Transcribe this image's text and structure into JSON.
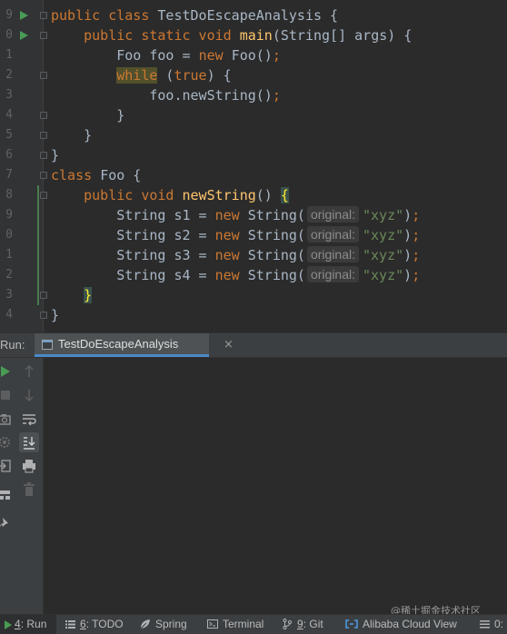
{
  "editor": {
    "line_numbers": [
      "9",
      "0",
      "1",
      "2",
      "3",
      "4",
      "5",
      "6",
      "7",
      "8",
      "9",
      "0",
      "1",
      "2",
      "3",
      "4"
    ],
    "lines": [
      [
        {
          "t": "public class ",
          "c": "kw"
        },
        {
          "t": "TestDoEscapeAnalysis {",
          "c": "ty"
        }
      ],
      [
        {
          "t": "    public static void ",
          "c": "kw"
        },
        {
          "t": "main",
          "c": "fn"
        },
        {
          "t": "(String[] args) {",
          "c": "ty"
        }
      ],
      [
        {
          "t": "        Foo foo = ",
          "c": "ty"
        },
        {
          "t": "new ",
          "c": "kw"
        },
        {
          "t": "Foo()",
          "c": "ty"
        },
        {
          "t": ";",
          "c": "kw"
        }
      ],
      [
        {
          "t": "        ",
          "c": "ty"
        },
        {
          "t": "while",
          "c": "kw hl"
        },
        {
          "t": " (",
          "c": "ty"
        },
        {
          "t": "true",
          "c": "kw"
        },
        {
          "t": ") {",
          "c": "ty"
        }
      ],
      [
        {
          "t": "            foo.newString()",
          "c": "ty"
        },
        {
          "t": ";",
          "c": "kw"
        }
      ],
      [
        {
          "t": "        }",
          "c": "ty"
        }
      ],
      [
        {
          "t": "    }",
          "c": "ty"
        }
      ],
      [
        {
          "t": "}",
          "c": "ty"
        }
      ],
      [
        {
          "t": "class ",
          "c": "kw"
        },
        {
          "t": "Foo {",
          "c": "ty"
        }
      ],
      [
        {
          "t": "    public void ",
          "c": "kw"
        },
        {
          "t": "newString",
          "c": "fn"
        },
        {
          "t": "() ",
          "c": "ty"
        },
        {
          "t": "{",
          "c": "brace-hl"
        }
      ],
      [
        {
          "t": "        String s1 = ",
          "c": "ty"
        },
        {
          "t": "new ",
          "c": "kw"
        },
        {
          "t": "String(",
          "c": "ty"
        },
        {
          "hint": "original:"
        },
        {
          "t": "\"xyz\"",
          "c": "str"
        },
        {
          "t": ")",
          "c": "ty"
        },
        {
          "t": ";",
          "c": "kw"
        }
      ],
      [
        {
          "t": "        String s2 = ",
          "c": "ty"
        },
        {
          "t": "new ",
          "c": "kw"
        },
        {
          "t": "String(",
          "c": "ty"
        },
        {
          "hint": "original:"
        },
        {
          "t": "\"xyz\"",
          "c": "str"
        },
        {
          "t": ")",
          "c": "ty"
        },
        {
          "t": ";",
          "c": "kw"
        }
      ],
      [
        {
          "t": "        String s3 = ",
          "c": "ty"
        },
        {
          "t": "new ",
          "c": "kw"
        },
        {
          "t": "String(",
          "c": "ty"
        },
        {
          "hint": "original:"
        },
        {
          "t": "\"xyz\"",
          "c": "str"
        },
        {
          "t": ")",
          "c": "ty"
        },
        {
          "t": ";",
          "c": "kw"
        }
      ],
      [
        {
          "t": "        String s4 = ",
          "c": "ty"
        },
        {
          "t": "new ",
          "c": "kw"
        },
        {
          "t": "String(",
          "c": "ty"
        },
        {
          "hint": "original:"
        },
        {
          "t": "\"xyz\"",
          "c": "str"
        },
        {
          "t": ")",
          "c": "ty"
        },
        {
          "t": ";",
          "c": "kw"
        }
      ],
      [
        {
          "t": "    ",
          "c": "ty"
        },
        {
          "t": "}",
          "c": "brace-hl"
        }
      ],
      [
        {
          "t": "}",
          "c": "ty"
        }
      ]
    ]
  },
  "run_panel": {
    "label": "Run:",
    "tab_title": "TestDoEscapeAnalysis",
    "close_glyph": "×"
  },
  "toolbar": {
    "col1_icons": [
      "run-icon",
      "stop-icon",
      "camera-icon",
      "settings-icon",
      "exit-icon",
      "layout-icon",
      "pin-icon"
    ],
    "col2_icons": [
      "up-arrow-icon",
      "down-arrow-icon",
      "soft-wrap-icon",
      "scroll-to-end-icon",
      "print-icon",
      "trash-icon"
    ]
  },
  "statusbar": {
    "run_num": "4",
    "run_label": ": Run",
    "todo_num": "6",
    "todo_label": ": TODO",
    "spring": "Spring",
    "terminal": "Terminal",
    "git_num": "9",
    "git_label": ": Git",
    "alibaba": "Alibaba Cloud View",
    "last": "0:"
  },
  "watermark": "@稀土掘金技术社区",
  "colors": {
    "keyword": "#cc7832",
    "function": "#ffc66d",
    "string": "#6a8759",
    "text": "#a9b7c6",
    "run_green": "#499c54",
    "accent_blue": "#4a88c7"
  }
}
